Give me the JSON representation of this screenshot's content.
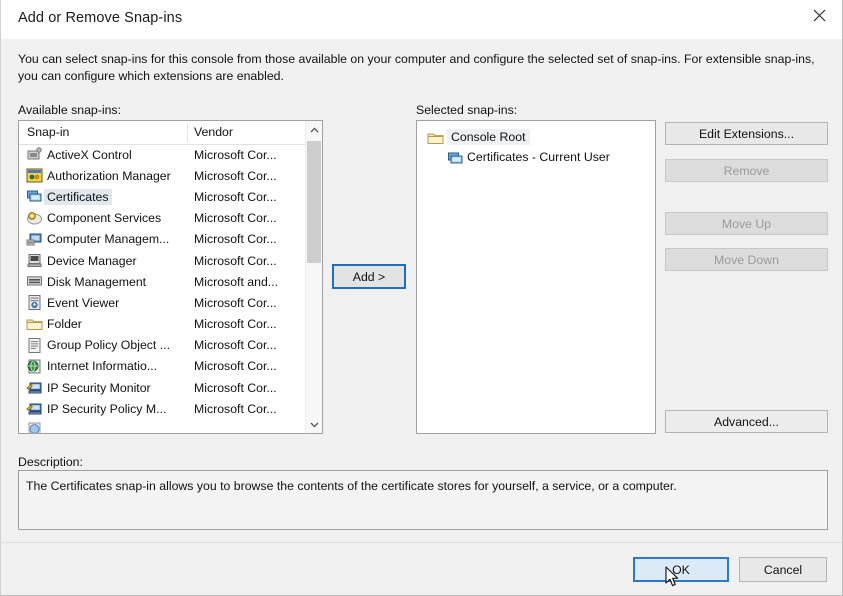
{
  "window": {
    "title": "Add or Remove Snap-ins",
    "close_icon": "close-icon"
  },
  "intro": {
    "text": "You can select snap-ins for this console from those available on your computer and configure the selected set of snap-ins. For extensible snap-ins, you can configure which extensions are enabled."
  },
  "available": {
    "label": "Available snap-ins:",
    "columns": {
      "snapin": "Snap-in",
      "vendor": "Vendor"
    },
    "selected_index": 2,
    "rows": [
      {
        "name": "ActiveX Control",
        "vendor": "Microsoft Cor...",
        "icon": "activex-control-icon"
      },
      {
        "name": "Authorization Manager",
        "vendor": "Microsoft Cor...",
        "icon": "authorization-manager-icon"
      },
      {
        "name": "Certificates",
        "vendor": "Microsoft Cor...",
        "icon": "certificates-icon"
      },
      {
        "name": "Component Services",
        "vendor": "Microsoft Cor...",
        "icon": "component-services-icon"
      },
      {
        "name": "Computer Managem...",
        "vendor": "Microsoft Cor...",
        "icon": "computer-management-icon"
      },
      {
        "name": "Device Manager",
        "vendor": "Microsoft Cor...",
        "icon": "device-manager-icon"
      },
      {
        "name": "Disk Management",
        "vendor": "Microsoft and...",
        "icon": "disk-management-icon"
      },
      {
        "name": "Event Viewer",
        "vendor": "Microsoft Cor...",
        "icon": "event-viewer-icon"
      },
      {
        "name": "Folder",
        "vendor": "Microsoft Cor...",
        "icon": "folder-icon"
      },
      {
        "name": "Group Policy Object ...",
        "vendor": "Microsoft Cor...",
        "icon": "group-policy-object-icon"
      },
      {
        "name": "Internet Informatio...",
        "vendor": "Microsoft Cor...",
        "icon": "internet-information-services-icon"
      },
      {
        "name": "IP Security Monitor",
        "vendor": "Microsoft Cor...",
        "icon": "ip-security-monitor-icon"
      },
      {
        "name": "IP Security Policy M...",
        "vendor": "Microsoft Cor...",
        "icon": "ip-security-policy-management-icon"
      },
      {
        "name": "",
        "vendor": "",
        "icon": "link-to-web-address-icon"
      }
    ],
    "scrollbar": {
      "up_arrow": "⌃",
      "down_arrow": "⌄"
    }
  },
  "selected": {
    "label": "Selected snap-ins:",
    "tree": [
      {
        "label": "Console Root",
        "icon": "folder-icon",
        "level": 0,
        "highlighted": true
      },
      {
        "label": "Certificates - Current User",
        "icon": "certificates-icon",
        "level": 1,
        "highlighted": false
      }
    ]
  },
  "buttons": {
    "add": "Add >",
    "edit_extensions": "Edit Extensions...",
    "remove": "Remove",
    "move_up": "Move Up",
    "move_down": "Move Down",
    "advanced": "Advanced...",
    "ok": "OK",
    "cancel": "Cancel"
  },
  "description": {
    "label": "Description:",
    "text": "The Certificates snap-in allows you to browse the contents of the certificate stores for yourself, a service, or a computer."
  },
  "colors": {
    "dialog_bg": "#f0f0f0",
    "accent": "#2a7ac9",
    "selection": "#dfe7ef",
    "button_face": "#e1e1e1",
    "disabled_text": "#9a9a9a"
  }
}
